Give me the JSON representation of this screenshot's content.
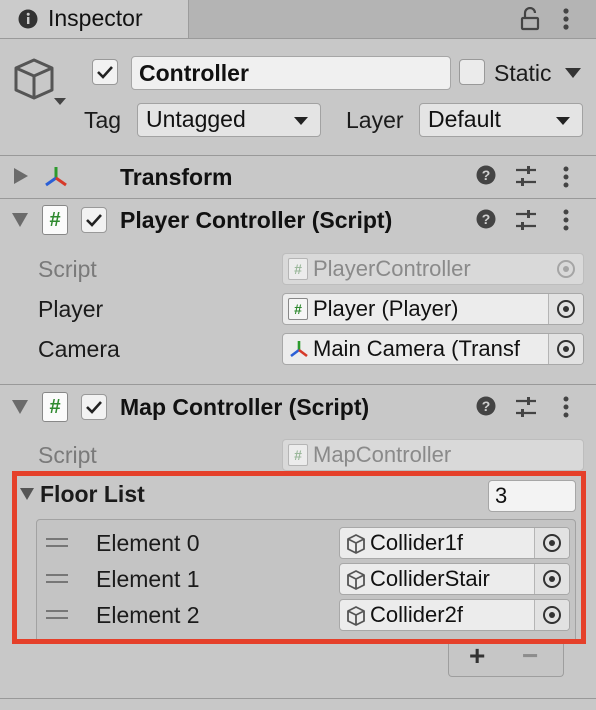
{
  "window": {
    "tab_title": "Inspector",
    "tab_icon": "info-icon",
    "lock_icon": "lock-icon",
    "menu_icon": "kebab-menu-icon"
  },
  "object": {
    "icon": "gameobject-cube-icon",
    "active": true,
    "name": "Controller",
    "static_label": "Static",
    "static_checked": false,
    "tag_label": "Tag",
    "tag_value": "Untagged",
    "layer_label": "Layer",
    "layer_value": "Default"
  },
  "components": {
    "transform": {
      "title": "Transform",
      "expanded": false
    },
    "player_controller": {
      "title": "Player Controller (Script)",
      "enabled": true,
      "fields": [
        {
          "label": "Script",
          "value": "PlayerController",
          "icon": "script-icon",
          "disabled": true
        },
        {
          "label": "Player",
          "value": "Player (Player)",
          "icon": "script-icon",
          "disabled": false
        },
        {
          "label": "Camera",
          "value": "Main Camera (Transf",
          "icon": "transform-icon",
          "disabled": false
        }
      ]
    },
    "map_controller": {
      "title": "Map Controller (Script)",
      "enabled": true,
      "script_label": "Script",
      "script_value": "MapController",
      "floor_list": {
        "label": "Floor List",
        "size": "3",
        "elements": [
          {
            "label": "Element 0",
            "value": "Collider1f"
          },
          {
            "label": "Element 1",
            "value": "ColliderStair"
          },
          {
            "label": "Element 2",
            "value": "Collider2f"
          }
        ],
        "add_label": "+",
        "remove_label": "−"
      }
    }
  },
  "colors": {
    "panel_bg": "#c8c8c8",
    "highlight": "#e5402a",
    "script_green": "#2f8a2f"
  }
}
